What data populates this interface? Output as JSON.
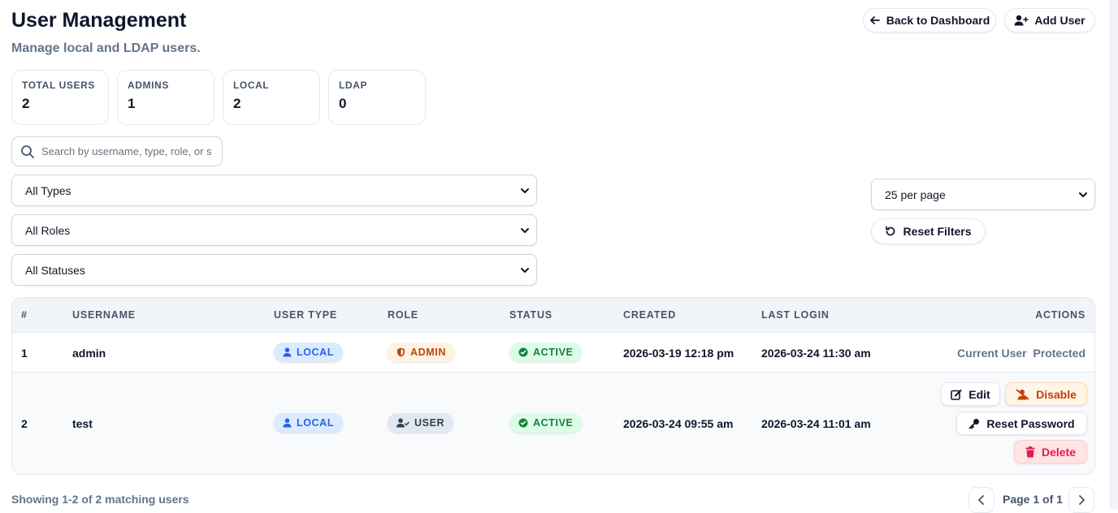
{
  "header": {
    "title": "User Management",
    "subtitle": "Manage local and LDAP users.",
    "back_button": "Back to Dashboard",
    "add_button": "Add User"
  },
  "stats": [
    {
      "label": "TOTAL USERS",
      "value": "2"
    },
    {
      "label": "ADMINS",
      "value": "1"
    },
    {
      "label": "LOCAL",
      "value": "2"
    },
    {
      "label": "LDAP",
      "value": "0"
    }
  ],
  "filters": {
    "search_placeholder": "Search by username, type, role, or status",
    "type_selected": "All Types",
    "role_selected": "All Roles",
    "status_selected": "All Statuses",
    "per_page_selected": "25 per page",
    "reset_label": "Reset Filters"
  },
  "table": {
    "columns": [
      "#",
      "USERNAME",
      "USER TYPE",
      "ROLE",
      "STATUS",
      "CREATED",
      "LAST LOGIN",
      "ACTIONS"
    ],
    "rows": [
      {
        "index": "1",
        "username": "admin",
        "user_type": "LOCAL",
        "role": "ADMIN",
        "status": "ACTIVE",
        "created": "2026-03-19 12:18 pm",
        "last_login": "2026-03-24 11:30 am",
        "actions_note_1": "Current User",
        "actions_note_2": "Protected"
      },
      {
        "index": "2",
        "username": "test",
        "user_type": "LOCAL",
        "role": "USER",
        "status": "ACTIVE",
        "created": "2026-03-24 09:55 am",
        "last_login": "2026-03-24 11:01 am",
        "actions": {
          "edit": "Edit",
          "disable": "Disable",
          "reset_password": "Reset Password",
          "delete": "Delete"
        }
      }
    ]
  },
  "footer": {
    "showing": "Showing 1-2 of 2 matching users",
    "page": "Page 1 of 1"
  },
  "colors": {
    "accent_blue": "#2563eb",
    "admin_orange": "#c2410c",
    "active_green": "#15803d",
    "delete_red": "#e11d48"
  },
  "icons": [
    "arrow-left-icon",
    "user-plus-icon",
    "search-icon",
    "chevron-down-icon",
    "rotate-ccw-icon",
    "user-icon",
    "shield-icon",
    "user-check-icon",
    "check-circle-icon",
    "edit-icon",
    "user-slash-icon",
    "key-icon",
    "trash-icon",
    "chevron-left-icon",
    "chevron-right-icon"
  ]
}
